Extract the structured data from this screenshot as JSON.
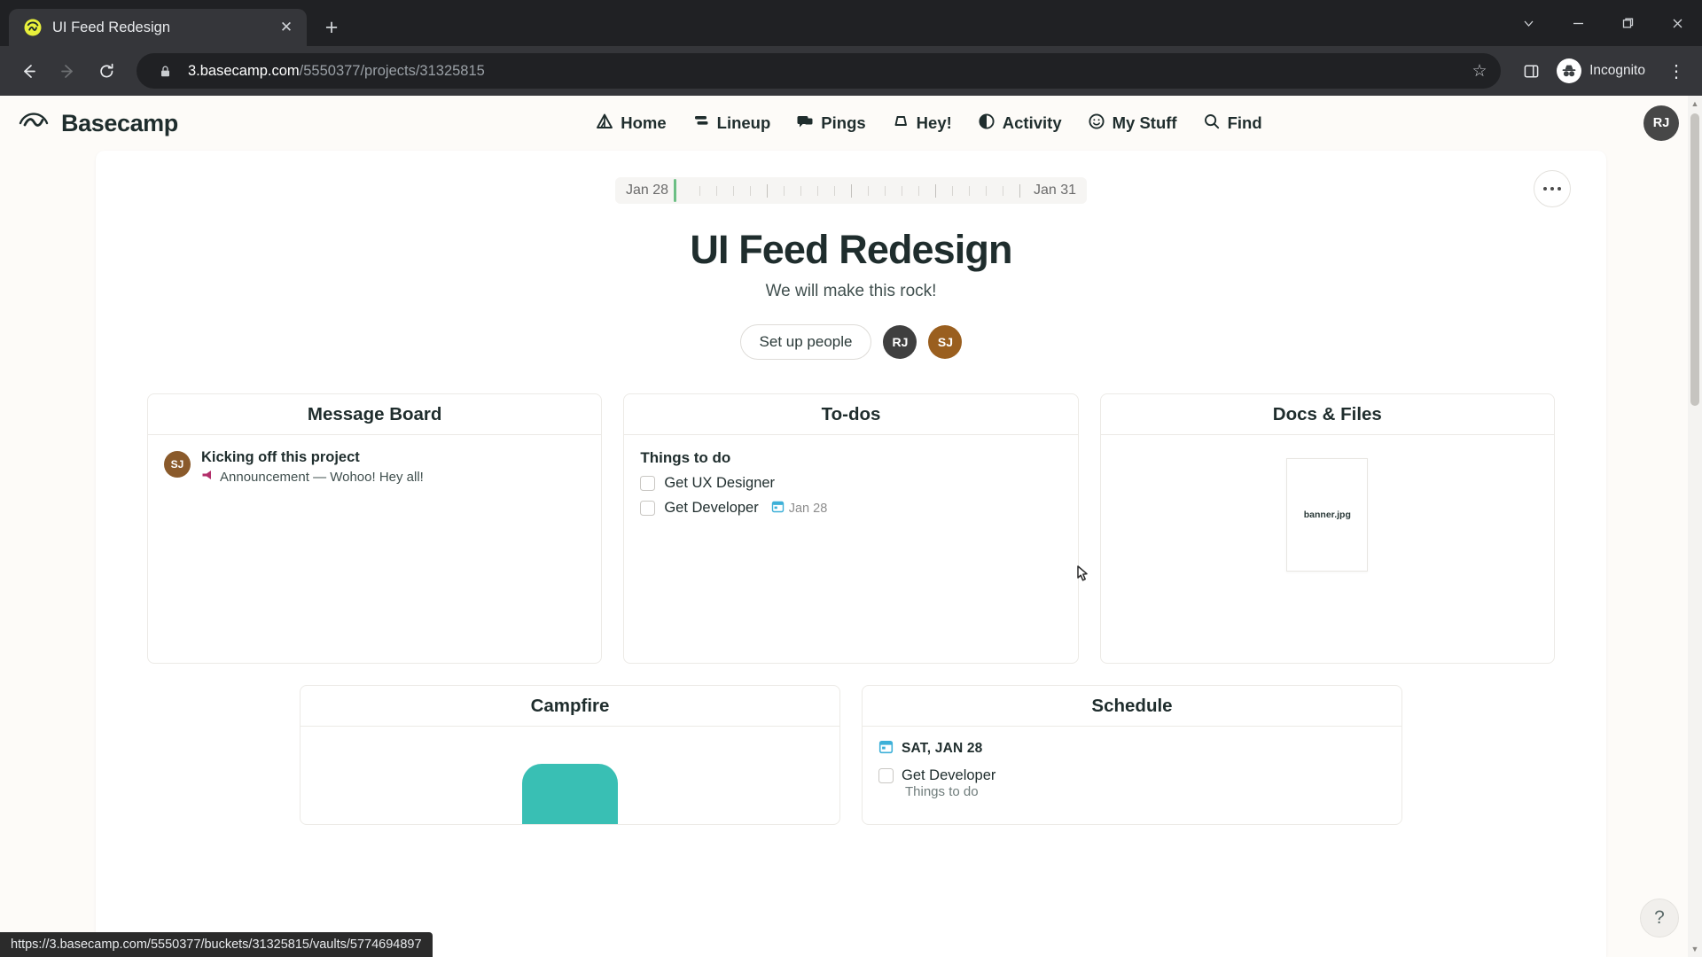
{
  "browser": {
    "tab": {
      "title": "UI Feed Redesign",
      "favicon": "basecamp-logo-icon",
      "close": "✕"
    },
    "new_tab_label": "+",
    "window_controls": {
      "expand": "⌄",
      "minimize": "—",
      "restore": "❐",
      "close": "✕"
    },
    "nav": {
      "back": "←",
      "forward": "→",
      "reload": "↻"
    },
    "omnibox": {
      "lock_icon": "lock-icon",
      "host": "3.basecamp.com",
      "path": "/5550377/projects/31325815",
      "bookmark_icon": "☆",
      "sidepanel_icon": "side-panel-icon"
    },
    "incognito_label": "Incognito",
    "menu_icon": "⋮",
    "status_url": "https://3.basecamp.com/5550377/buckets/31325815/vaults/5774694897"
  },
  "appnav": {
    "brand": "Basecamp",
    "items": [
      {
        "label": "Home",
        "icon": "home-tent-icon"
      },
      {
        "label": "Lineup",
        "icon": "lineup-bars-icon"
      },
      {
        "label": "Pings",
        "icon": "pings-chat-icon"
      },
      {
        "label": "Hey!",
        "icon": "hey-megaphone-icon"
      },
      {
        "label": "Activity",
        "icon": "activity-moon-icon"
      },
      {
        "label": "My Stuff",
        "icon": "my-stuff-smile-icon"
      },
      {
        "label": "Find",
        "icon": "search-icon"
      }
    ],
    "account_avatar": {
      "initials": "RJ",
      "color": "#474747"
    }
  },
  "project": {
    "date_start": "Jan 28",
    "date_end": "Jan 31",
    "marker_color": "#6cbf84",
    "more_menu_icon": "ellipsis-icon",
    "title": "UI Feed Redesign",
    "tagline": "We will make this rock!",
    "setup_people_label": "Set up people",
    "members": [
      {
        "initials": "RJ",
        "color": "#3f3f3f"
      },
      {
        "initials": "SJ",
        "color": "#9a5f1f"
      }
    ]
  },
  "cards": [
    {
      "name": "message-board",
      "title": "Message Board",
      "message": {
        "avatar": {
          "initials": "SJ",
          "color": "#8a5a2b"
        },
        "title": "Kicking off this project",
        "icon": "megaphone-icon",
        "meta": "Announcement — Wohoo! Hey all!"
      }
    },
    {
      "name": "to-dos",
      "title": "To-dos",
      "group_title": "Things to do",
      "items": [
        {
          "label": "Get UX Designer",
          "due": ""
        },
        {
          "label": "Get Developer",
          "due": "Jan 28",
          "due_icon": "calendar-icon"
        }
      ]
    },
    {
      "name": "docs-and-files",
      "title": "Docs & Files",
      "file_name": "banner.jpg"
    }
  ],
  "cards_row2": [
    {
      "name": "campfire",
      "title": "Campfire",
      "icon": "chat-bubble-icon",
      "icon_color": "#39bfb4"
    },
    {
      "name": "schedule",
      "title": "Schedule",
      "date_icon": "calendar-icon",
      "date_label": "SAT, JAN 28",
      "entry": "Get Developer",
      "entry_sub": "Things to do"
    }
  ],
  "help": {
    "icon": "?"
  }
}
